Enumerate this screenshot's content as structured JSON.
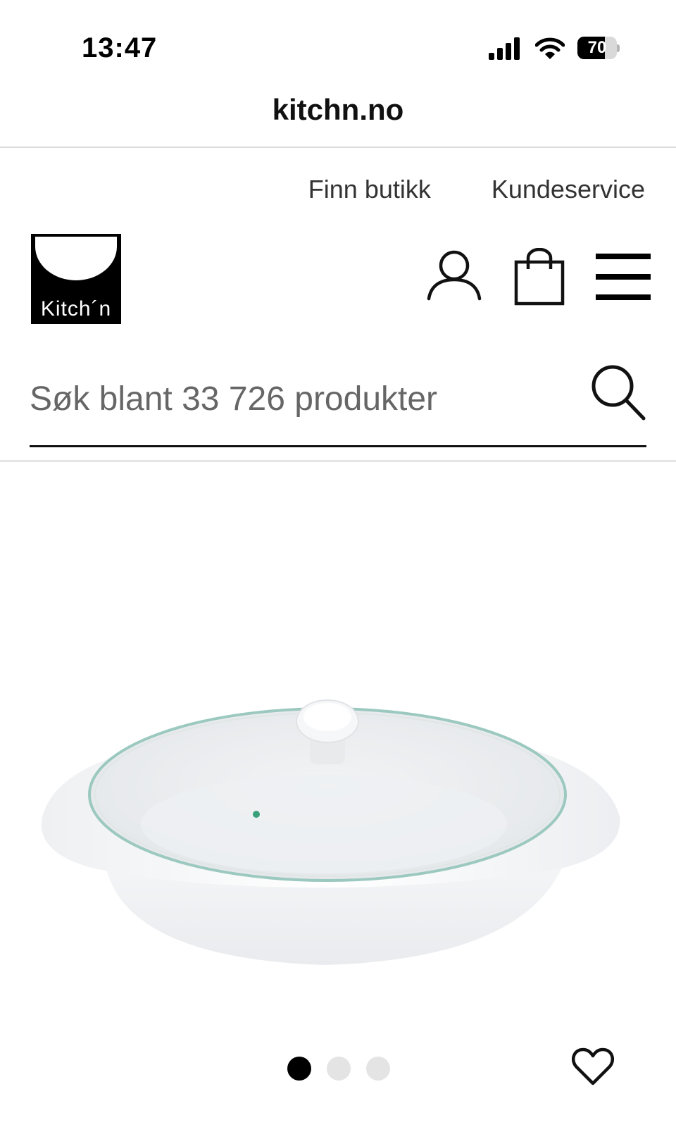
{
  "status_bar": {
    "time": "13:47",
    "battery_level": "70",
    "battery_fraction": 0.7
  },
  "browser": {
    "url": "kitchn.no"
  },
  "utility_nav": {
    "find_store": "Finn butikk",
    "customer_service": "Kundeservice"
  },
  "header": {
    "logo_text": "Kitch´n",
    "icons": [
      "user-icon",
      "shopping-bag-icon",
      "hamburger-menu-icon"
    ]
  },
  "search": {
    "placeholder": "Søk blant 33 726 produkter",
    "value": ""
  },
  "product": {
    "image_description_icon": "product-image",
    "carousel": {
      "total": 3,
      "active_index": 0
    },
    "favorite_icon": "heart-icon"
  },
  "colors": {
    "text": "#111111",
    "divider": "#dcdcdc",
    "dot_inactive": "#e4e4e4",
    "dot_active": "#000000"
  }
}
